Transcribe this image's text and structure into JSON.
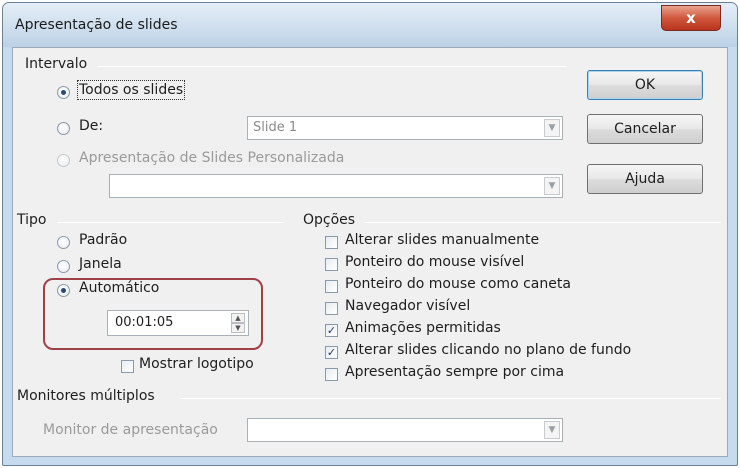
{
  "window": {
    "title": "Apresentação de slides",
    "close_glyph": "x"
  },
  "intervalo": {
    "label": "Intervalo",
    "todos": "Todos os slides",
    "de": "De:",
    "de_value": "Slide 1",
    "personalizada": "Apresentação de Slides Personalizada",
    "personalizada_value": "",
    "selected": "todos"
  },
  "buttons": {
    "ok": "OK",
    "cancelar": "Cancelar",
    "ajuda": "Ajuda"
  },
  "tipo": {
    "label": "Tipo",
    "padrao": "Padrão",
    "janela": "Janela",
    "automatico": "Automático",
    "selected": "automatico",
    "time": "00:01:05",
    "mostrar_logotipo": "Mostrar logotipo",
    "mostrar_logotipo_checked": false
  },
  "opcoes": {
    "label": "Opções",
    "items": [
      {
        "label": "Alterar slides manualmente",
        "checked": false
      },
      {
        "label": "Ponteiro do mouse visível",
        "checked": false
      },
      {
        "label": "Ponteiro do mouse como caneta",
        "checked": false
      },
      {
        "label": "Navegador visível",
        "checked": false
      },
      {
        "label": "Animações permitidas",
        "checked": true
      },
      {
        "label": "Alterar slides clicando no plano de fundo",
        "checked": true
      },
      {
        "label": "Apresentação sempre por cima",
        "checked": false
      }
    ]
  },
  "monitores": {
    "label": "Monitores múltiplos",
    "monitor_label": "Monitor de apresentação",
    "monitor_value": ""
  },
  "colors": {
    "title_bar": "#cfdfee",
    "client_bg": "#f0f0f0",
    "highlight": "#a04048",
    "close_button": "#d0573d"
  },
  "icons": {
    "close": "close-icon",
    "dropdown": "chevron-down-icon",
    "spin_up": "spin-up-icon",
    "spin_down": "spin-down-icon"
  }
}
